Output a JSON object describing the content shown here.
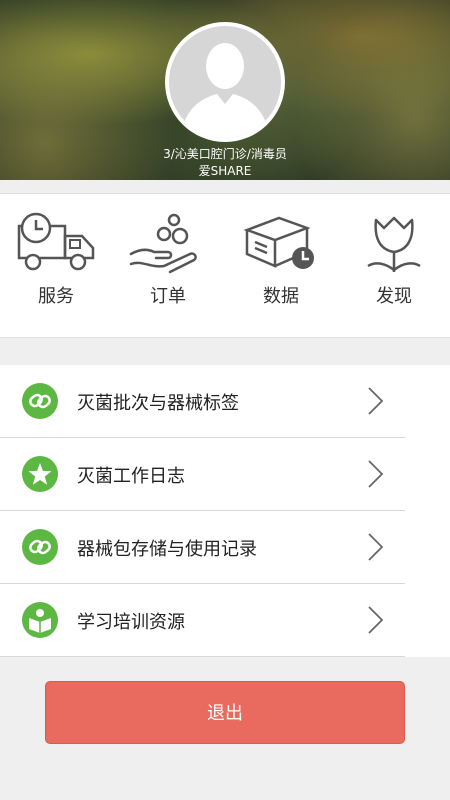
{
  "profile": {
    "line1": "3/沁美口腔门诊/消毒员",
    "line2": "爱SHARE"
  },
  "menu_grid": [
    {
      "label": "服务",
      "icon": "delivery-truck-clock-icon"
    },
    {
      "label": "订单",
      "icon": "hand-coins-icon"
    },
    {
      "label": "数据",
      "icon": "box-clock-icon"
    },
    {
      "label": "发现",
      "icon": "tulip-icon"
    }
  ],
  "list": [
    {
      "label": "灭菌批次与器械标签",
      "icon": "link-icon"
    },
    {
      "label": "灭菌工作日志",
      "icon": "star-icon"
    },
    {
      "label": "器械包存储与使用记录",
      "icon": "link-icon"
    },
    {
      "label": "学习培训资源",
      "icon": "book-reader-icon"
    }
  ],
  "logout_label": "退出",
  "colors": {
    "accent_green": "#5cb843",
    "logout_red": "#e96a5e"
  }
}
